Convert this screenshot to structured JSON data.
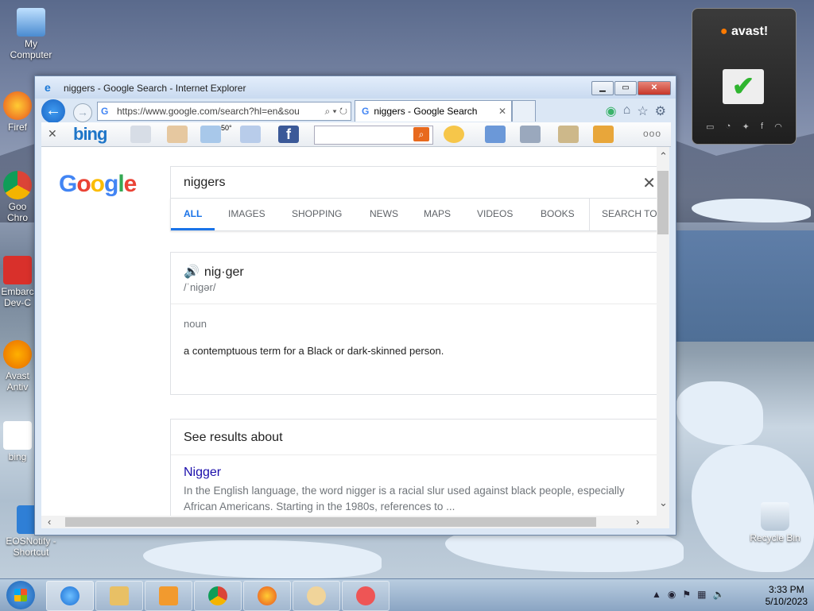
{
  "desktop": {
    "icons": [
      {
        "label": "My Computer"
      },
      {
        "label": "Firef"
      },
      {
        "label": "Goo Chro"
      },
      {
        "label": "Embarc Dev-C"
      },
      {
        "label": "Avast Antiv"
      },
      {
        "label": "bing"
      },
      {
        "label": "EOSNotify - Shortcut"
      },
      {
        "label": "Recycle Bin"
      }
    ]
  },
  "ie": {
    "title": "niggers - Google Search - Internet Explorer",
    "address": "https://www.google.com/search?hl=en&sou",
    "tab_label": "niggers - Google Search",
    "bing_logo": "bing",
    "weather": "50°",
    "more": "ooo"
  },
  "google": {
    "logo": "Google",
    "query": "niggers",
    "tabs": [
      "ALL",
      "IMAGES",
      "SHOPPING",
      "NEWS",
      "MAPS",
      "VIDEOS",
      "BOOKS",
      "SEARCH TO"
    ],
    "dictionary": {
      "word": "nig·ger",
      "pronunciation": "/ˈniɡər/",
      "pos": "noun",
      "definition": "a contemptuous term for a Black or dark-skinned person."
    },
    "results_about": {
      "title": "See results about",
      "link": "Nigger",
      "snippet": "In the English language, the word nigger is a racial slur used against black people, especially African Americans. Starting in the 1980s, references to ..."
    }
  },
  "avast": {
    "brand": "avast!"
  },
  "taskbar": {
    "time": "3:33 PM",
    "date": "5/10/2023"
  }
}
